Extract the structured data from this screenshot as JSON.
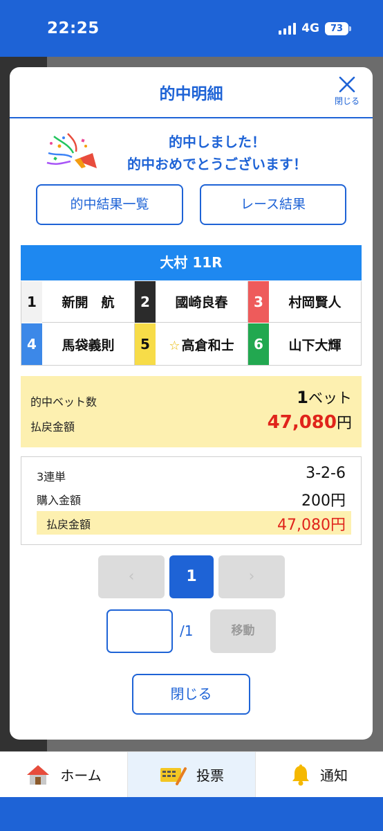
{
  "status": {
    "time": "22:25",
    "network": "4G",
    "battery": "73"
  },
  "modal": {
    "title": "的中明細",
    "close_label": "閉じる",
    "message_line1": "的中しました！",
    "message_line2": "的中おめでとうございます！",
    "buttons": {
      "hit_list": "的中結果一覧",
      "race_result": "レース結果"
    },
    "race": "大村 11R",
    "racers": [
      {
        "num": "1",
        "name": "新開　航",
        "color": "#f2f2f2"
      },
      {
        "num": "2",
        "name": "國崎良春",
        "color": "#2b2b2b"
      },
      {
        "num": "3",
        "name": "村岡賢人",
        "color": "#ee5b5b"
      },
      {
        "num": "4",
        "name": "馬袋義則",
        "color": "#3c88e8"
      },
      {
        "num": "5",
        "name": "高倉和士",
        "color": "#f7dc48",
        "star": "☆"
      },
      {
        "num": "6",
        "name": "山下大輝",
        "color": "#22a850"
      }
    ],
    "summary": {
      "hit_bets_label": "的中ベット数",
      "hit_bets_value": "1",
      "hit_bets_unit": "ベット",
      "payout_label": "払戻金額",
      "payout_value": "47,080",
      "payout_unit": "円"
    },
    "detail": {
      "bet_type": "3連単",
      "combination": "3-2-6",
      "purchase_label": "購入金額",
      "purchase_value": "200円",
      "payout_label": "払戻金額",
      "payout_value": "47,080円"
    },
    "pager": {
      "prev": "‹",
      "current": "1",
      "next": "›",
      "total": "/1",
      "move": "移動",
      "input_value": ""
    },
    "close_button": "閉じる"
  },
  "tabs": [
    {
      "label": "ホーム"
    },
    {
      "label": "投票",
      "active": true
    },
    {
      "label": "通知"
    }
  ],
  "colors": {
    "accent": "#1e63d6",
    "race_bar": "#1e88f0",
    "payout": "#e0241b",
    "highlight": "#fdf0b0"
  }
}
